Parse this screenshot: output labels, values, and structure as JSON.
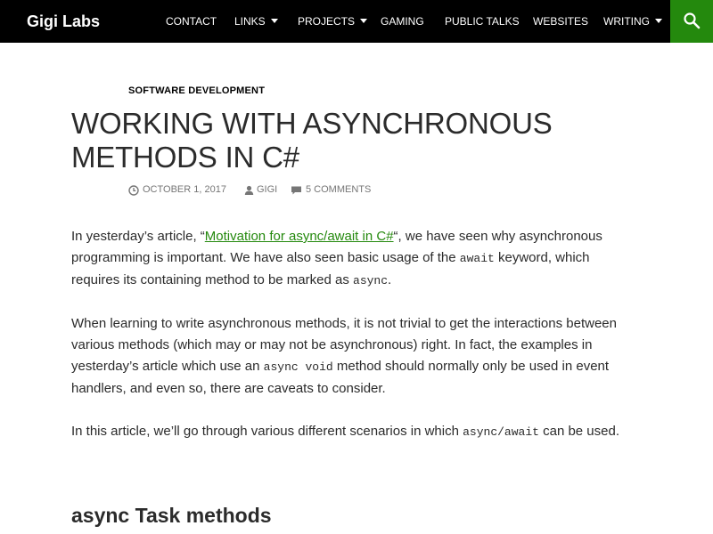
{
  "header": {
    "site_title": "Gigi Labs",
    "nav": [
      {
        "label": "CONTACT",
        "dropdown": false
      },
      {
        "label": "LINKS",
        "dropdown": true
      },
      {
        "label": "PROJECTS",
        "dropdown": true
      },
      {
        "label": "GAMING",
        "dropdown": false
      },
      {
        "label": "PUBLIC TALKS",
        "dropdown": false
      },
      {
        "label": "WEBSITES",
        "dropdown": false
      },
      {
        "label": "WRITING",
        "dropdown": true
      }
    ],
    "search_icon": "search-icon",
    "accent": "#24890d",
    "background": "#000000"
  },
  "article": {
    "category": "SOFTWARE DEVELOPMENT",
    "title": "WORKING WITH ASYNCHRONOUS METHODS IN C#",
    "meta": {
      "date": "OCTOBER 1, 2017",
      "author": "GIGI",
      "comments": "5 COMMENTS"
    },
    "paragraphs": {
      "p1": {
        "before": "In yesterday’s article, “",
        "link": "Motivation for async/await in C#",
        "after_link": "“, we have seen why asynchronous programming is important. We have also seen basic usage of the ",
        "code1": "await",
        "middle": " keyword, which requires its containing method to be marked as ",
        "code2": "async",
        "end": "."
      },
      "p2": {
        "before": "When learning to write asynchronous methods, it is not trivial to get the interactions between various methods (which may or may not be asynchronous) right. In fact, the examples in yesterday’s article which use an ",
        "code": "async void",
        "after": " method should normally only be used in event handlers, and even so, there are caveats to consider."
      },
      "p3": {
        "before": "In this article, we’ll go through various different scenarios in which ",
        "code": "async/await",
        "after": " can be used."
      }
    },
    "section_heading": "async Task methods"
  }
}
